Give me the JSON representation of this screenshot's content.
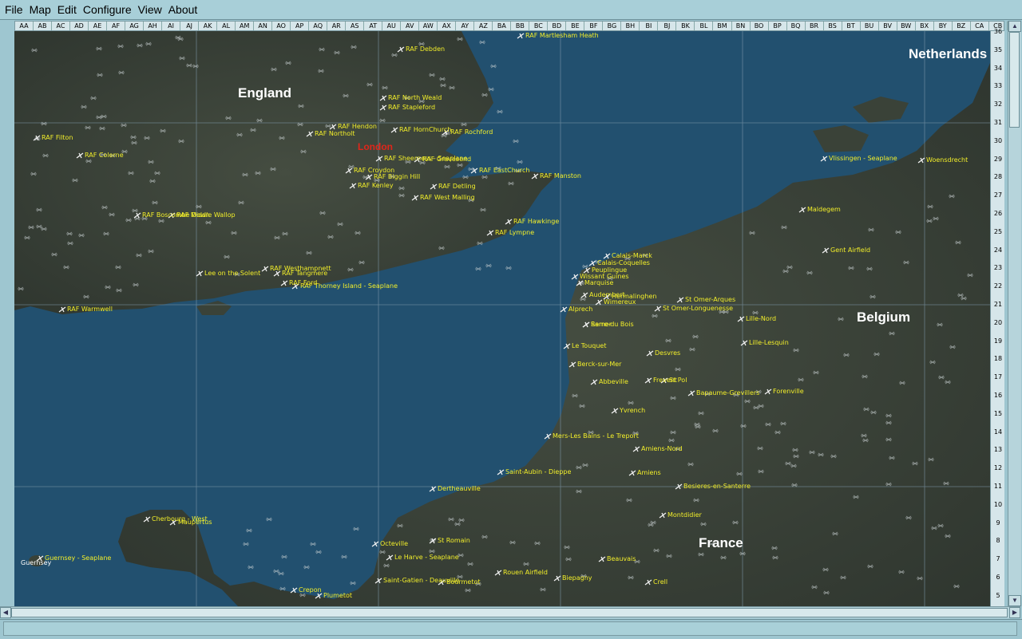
{
  "menu": [
    "File",
    "Map",
    "Edit",
    "Configure",
    "View",
    "About"
  ],
  "columns": [
    "AA",
    "AB",
    "AC",
    "AD",
    "AE",
    "AF",
    "AG",
    "AH",
    "AI",
    "AJ",
    "AK",
    "AL",
    "AM",
    "AN",
    "AO",
    "AP",
    "AQ",
    "AR",
    "AS",
    "AT",
    "AU",
    "AV",
    "AW",
    "AX",
    "AY",
    "AZ",
    "BA",
    "BB",
    "BC",
    "BD",
    "BE",
    "BF",
    "BG",
    "BH",
    "BI",
    "BJ",
    "BK",
    "BL",
    "BM",
    "BN",
    "BO",
    "BP",
    "BQ",
    "BR",
    "BS",
    "BT",
    "BU",
    "BV",
    "BW",
    "BX",
    "BY",
    "BZ",
    "CA",
    "CB"
  ],
  "rows": [
    "36",
    "35",
    "34",
    "33",
    "32",
    "31",
    "30",
    "29",
    "28",
    "27",
    "26",
    "25",
    "24",
    "23",
    "22",
    "21",
    "20",
    "19",
    "18",
    "17",
    "16",
    "15",
    "14",
    "13",
    "12",
    "11",
    "10",
    "9",
    "8",
    "7",
    "6",
    "5"
  ],
  "countries": [
    "England",
    "Netherlands",
    "Belgium",
    "France"
  ],
  "city": "London",
  "airfields": [
    "RAF Martlesham Heath",
    "RAF Debden",
    "RAF North Weald",
    "RAF Stapleford",
    "RAF Filton",
    "RAF Hendon",
    "RAF Northolt",
    "RAF HornChurch",
    "RAF Rochford",
    "RAF Colerne",
    "RAF Sheerness - Seaplane",
    "RAF Gravesend",
    "RAF Croydon",
    "RAF Biggin Hill",
    "RAF Kenley",
    "RAF EastChurch",
    "RAF Manston",
    "RAF Detling",
    "RAF West Malling",
    "RAF Hawkinge",
    "RAF Lympne",
    "RAF Boscombe Down",
    "RAF Middle Wallop",
    "RAF Westhampnett",
    "RAF Tangmere",
    "RAF Ford",
    "RAF Thorney Island - Seaplane",
    "Lee on the Solent",
    "RAF Warmwell",
    "Vlissingen - Seaplane",
    "Woensdrecht",
    "Maldegem",
    "Gent Airfield",
    "Calais-Marck",
    "Calais-Coquelles",
    "Peuplingue",
    "Wissant Guines",
    "Marquise",
    "St Omer-Arques",
    "Audembert",
    "Hermalinghen",
    "St Omer-Longuenesse",
    "Wimereux",
    "Alprech",
    "Lille-Nord",
    "Samer",
    "Lille-Lesquin",
    "Le Touquet",
    "Desvres",
    "Berck-sur-Mer",
    "Frevent",
    "St Pol",
    "Abbeville",
    "Bapaume-Grevillers",
    "Forenville",
    "Yvrench",
    "Mers-Les Bains - Le Treport",
    "Amiens-Nord",
    "Saint-Aubin - Dieppe",
    "Amiens",
    "Dertheauville",
    "Besieres-en-Santerre",
    "Cherbourg - West",
    "Maupertus",
    "Montdidier",
    "Octeville",
    "St Romain",
    "Guernsey - Seaplane",
    "Le Harve - Seaplane",
    "Beauvais",
    "Rouen Airfield",
    "Saint-Gatien - Deauville",
    "Bourmetot",
    "Biepagny",
    "Crell",
    "Crepon",
    "Plumetot",
    "Rerre-du Bois"
  ],
  "island_label": "Guernsey",
  "colors": {
    "water": "#1f4a6c",
    "land": "#3a4238",
    "airfield_text": "#f2ee2a",
    "city": "#e0261a",
    "chrome": "#a8cfd8"
  }
}
